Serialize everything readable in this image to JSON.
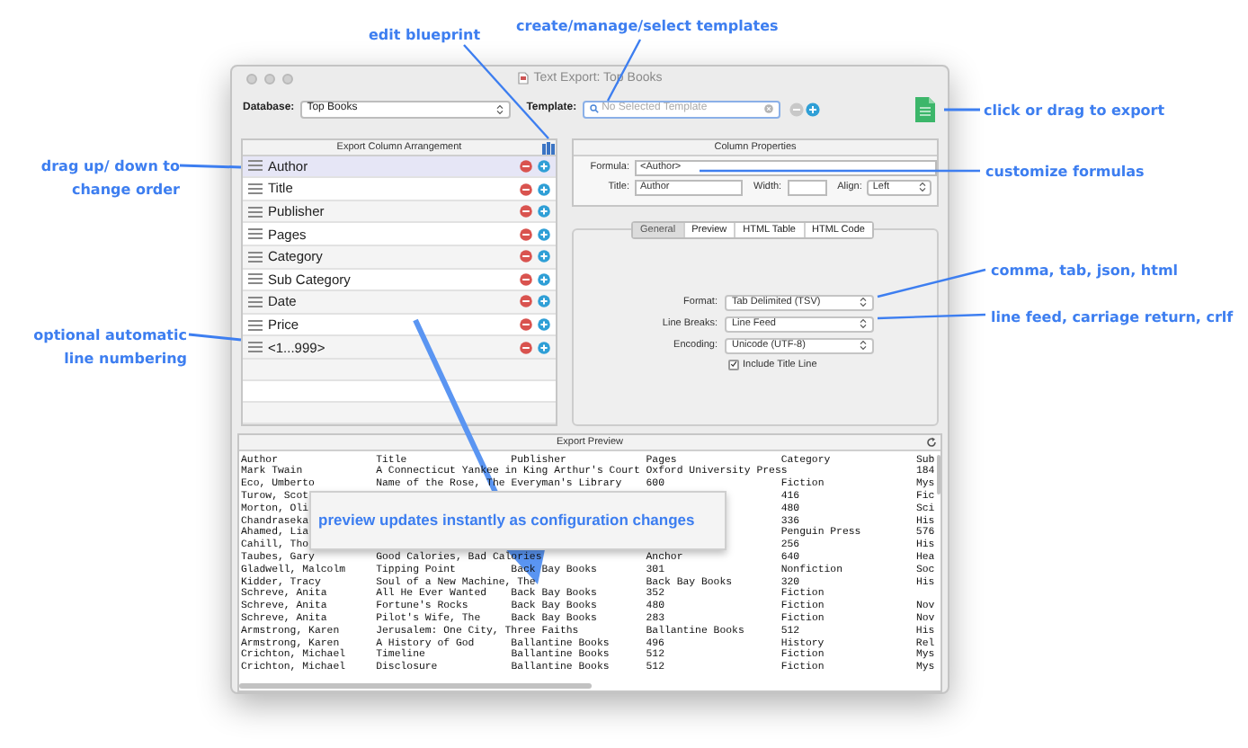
{
  "annotations": [
    {
      "text": "edit blueprint"
    },
    {
      "text": "create/manage/select templates"
    },
    {
      "text": "click or drag to export"
    },
    {
      "text": "drag up/ down to change order"
    },
    {
      "text": "optional automatic line numbering"
    },
    {
      "text": "customize formulas"
    },
    {
      "text": "comma, tab, json, html"
    },
    {
      "text": "line feed, carriage return, crlf"
    }
  ],
  "callout": "preview updates instantly as configuration changes",
  "window": {
    "title": "Text Export: Top Books"
  },
  "toolbar": {
    "database_label": "Database:",
    "database": "Top Books",
    "template_label": "Template:",
    "template_placeholder": "No Selected Template"
  },
  "columns_panel": {
    "title": "Export Column Arrangement",
    "items": [
      {
        "label": "Author",
        "selected": true
      },
      {
        "label": "Title",
        "selected": false
      },
      {
        "label": "Publisher",
        "selected": false
      },
      {
        "label": "Pages",
        "selected": false
      },
      {
        "label": "Category",
        "selected": false
      },
      {
        "label": "Sub Category",
        "selected": false
      },
      {
        "label": "Date",
        "selected": false
      },
      {
        "label": "Price",
        "selected": false
      },
      {
        "label": "<1...999>",
        "selected": false
      }
    ]
  },
  "properties": {
    "title": "Column Properties",
    "formula_label": "Formula:",
    "formula": "<Author>",
    "title_label": "Title:",
    "title_value": "Author",
    "width_label": "Width:",
    "align_label": "Align:",
    "align": "Left"
  },
  "tabs": [
    {
      "label": "General",
      "selected": true
    },
    {
      "label": "Preview",
      "selected": false
    },
    {
      "label": "HTML Table",
      "selected": false
    },
    {
      "label": "HTML Code",
      "selected": false
    }
  ],
  "options": {
    "fields": [
      {
        "label": "Format:",
        "value": "Tab Delimited (TSV)"
      },
      {
        "label": "Line Breaks:",
        "value": "Line Feed"
      },
      {
        "label": "Encoding:",
        "value": "Unicode (UTF-8)"
      }
    ],
    "include_title_line": {
      "label": "Include Title Line",
      "checked": true
    }
  },
  "preview": {
    "title": "Export Preview",
    "rows": [
      [
        "Author",
        "Title",
        "Publisher",
        "Pages",
        "Category",
        "Sub"
      ],
      [
        "Mark Twain",
        "A Connecticut Yankee in King Arthur's Court",
        "",
        "Oxford University Press",
        "",
        "184"
      ],
      [
        "Eco, Umberto",
        "Name of the Rose, The",
        "Everyman's Library",
        "600",
        "Fiction",
        "Mys"
      ],
      [
        "Turow, Scot",
        "",
        "",
        "",
        "416",
        "Fic"
      ],
      [
        "Morton, Oli",
        "",
        "",
        "",
        "480",
        "Sci"
      ],
      [
        "Chandraseka",
        "",
        "",
        "",
        "336",
        "His"
      ],
      [
        "Ahamed, Lia",
        "",
        "",
        "",
        "Penguin Press",
        "576"
      ],
      [
        "Cahill, Tho",
        "",
        "",
        "",
        "256",
        "His"
      ],
      [
        "Taubes, Gary",
        "Good Calories, Bad Calories",
        "",
        "Anchor",
        "640",
        "Hea"
      ],
      [
        "Gladwell, Malcolm",
        "Tipping Point",
        "Back Bay Books",
        "301",
        "Nonfiction",
        "Soc"
      ],
      [
        "Kidder, Tracy",
        "Soul of a New Machine, The",
        "",
        "Back Bay Books",
        "320",
        "His"
      ],
      [
        "Schreve, Anita",
        "All He Ever Wanted",
        "Back Bay Books",
        "352",
        "Fiction"
      ],
      [
        "Schreve, Anita",
        "Fortune's Rocks",
        "Back Bay Books",
        "480",
        "Fiction",
        "Nov"
      ],
      [
        "Schreve, Anita",
        "Pilot's Wife, The",
        "Back Bay Books",
        "283",
        "Fiction",
        "Nov"
      ],
      [
        "Armstrong, Karen",
        "Jerusalem: One City, Three Faiths",
        "",
        "Ballantine Books",
        "512",
        "His"
      ],
      [
        "Armstrong, Karen",
        "A History of God",
        "Ballantine Books",
        "496",
        "History",
        "Rel"
      ],
      [
        "Crichton, Michael",
        "Timeline",
        "Ballantine Books",
        "512",
        "Fiction",
        "Mys"
      ],
      [
        "Crichton, Michael",
        "Disclosure",
        "Ballantine Books",
        "512",
        "Fiction",
        "Mys"
      ]
    ]
  }
}
